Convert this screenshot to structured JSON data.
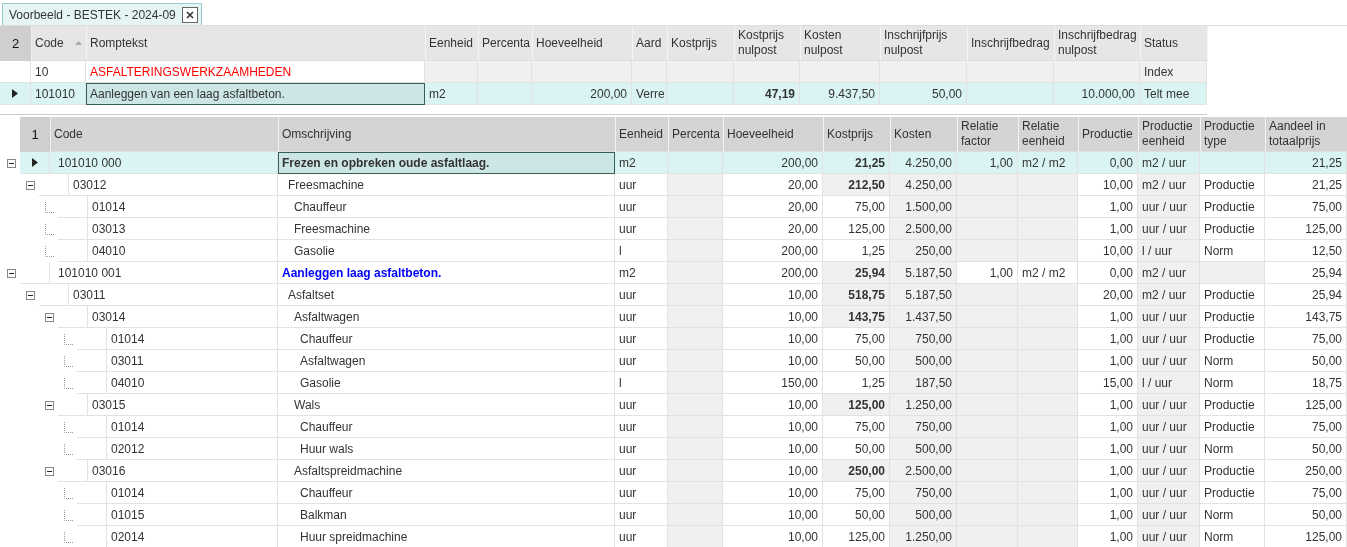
{
  "tab": {
    "title": "Voorbeeld - BESTEK - 2024-09"
  },
  "top_grid": {
    "level_indicator": "2",
    "columns": [
      {
        "label": "Code",
        "sorted": true
      },
      {
        "label": "Romptekst",
        "sorted": false
      },
      {
        "label": "Eenheid",
        "sorted": false
      },
      {
        "label": "Percenta",
        "sorted": false
      },
      {
        "label": "Hoeveelheid",
        "sorted": false
      },
      {
        "label": "Aard",
        "sorted": false
      },
      {
        "label": "Kostprijs",
        "sorted": false
      },
      {
        "label": "Kostprijs\nnulpost",
        "sorted": false
      },
      {
        "label": "Kosten\nnulpost",
        "sorted": false
      },
      {
        "label": "Inschrijfprijs\nnulpost",
        "sorted": false
      },
      {
        "label": "Inschrijfbedrag",
        "sorted": false
      },
      {
        "label": "Inschrijfbedrag\nnulpost",
        "sorted": false
      },
      {
        "label": "Status",
        "sorted": false
      }
    ],
    "rows": [
      {
        "kind": "group",
        "selected": false,
        "code": "10",
        "romptekst": "ASFALTERINGSWERKZAAMHEDEN",
        "status": "Index"
      },
      {
        "kind": "item",
        "selected": true,
        "code": "101010",
        "romptekst": "Aanleggen van een laag asfaltbeton.",
        "eenheid": "m2",
        "hoeveelheid": "200,00",
        "aard": "Verre",
        "kostprijs_nulpost": "47,19",
        "kosten_nulpost": "9.437,50",
        "inschrijfprijs_nulpost": "50,00",
        "inschrijfbedrag_nulpost": "10.000,00",
        "status": "Telt mee"
      }
    ]
  },
  "tree_grid": {
    "level_indicator": "1",
    "columns": [
      {
        "label": "Code"
      },
      {
        "label": "Omschrijving"
      },
      {
        "label": "Eenheid"
      },
      {
        "label": "Percenta"
      },
      {
        "label": "Hoeveelheid"
      },
      {
        "label": "Kostprijs"
      },
      {
        "label": "Kosten"
      },
      {
        "label": "Relatie\nfactor"
      },
      {
        "label": "Relatie\neenheid"
      },
      {
        "label": "Productie"
      },
      {
        "label": "Productie\neenheid"
      },
      {
        "label": "Productie\ntype"
      },
      {
        "label": "Aandeel in\ntotaalprijs"
      }
    ],
    "rows": [
      {
        "kind": "top",
        "selected": true,
        "expanded": true,
        "color": "#333333",
        "code": "101010 000",
        "omschrijving": "Frezen en opbreken oude asfaltlaag.",
        "eenheid": "m2",
        "hoeveelheid": "200,00",
        "kostprijs": "21,25",
        "kosten": "4.250,00",
        "relatie_factor": "1,00",
        "relatie_eenheid": "m2 / m2",
        "productie": "0,00",
        "productie_eenheid": "m2 / uur",
        "aandeel": "21,25",
        "children": [
          {
            "kind": "child",
            "selected": false,
            "expanded": true,
            "code": "03012",
            "omschrijving": "Freesmachine",
            "eenheid": "uur",
            "hoeveelheid": "20,00",
            "kostprijs": "212,50",
            "kosten": "4.250,00",
            "productie": "10,00",
            "productie_eenheid": "m2 / uur",
            "productie_type": "Productie",
            "aandeel": "21,25",
            "children": [
              {
                "kind": "child",
                "selected": false,
                "code": "01014",
                "omschrijving": "Chauffeur",
                "eenheid": "uur",
                "hoeveelheid": "20,00",
                "kostprijs": "75,00",
                "kosten": "1.500,00",
                "productie": "1,00",
                "productie_eenheid": "uur / uur",
                "productie_type": "Productie",
                "aandeel": "75,00"
              },
              {
                "kind": "child",
                "selected": false,
                "code": "03013",
                "omschrijving": "Freesmachine",
                "eenheid": "uur",
                "hoeveelheid": "20,00",
                "kostprijs": "125,00",
                "kosten": "2.500,00",
                "productie": "1,00",
                "productie_eenheid": "uur / uur",
                "productie_type": "Productie",
                "aandeel": "125,00"
              },
              {
                "kind": "child",
                "selected": false,
                "code": "04010",
                "omschrijving": "Gasolie",
                "eenheid": "l",
                "hoeveelheid": "200,00",
                "kostprijs": "1,25",
                "kosten": "250,00",
                "productie": "10,00",
                "productie_eenheid": "l / uur",
                "productie_type": "Norm",
                "aandeel": "12,50"
              }
            ]
          }
        ]
      },
      {
        "kind": "top",
        "selected": false,
        "expanded": true,
        "color": "#0000ff",
        "code": "101010 001",
        "omschrijving": "Aanleggen laag asfaltbeton.",
        "eenheid": "m2",
        "hoeveelheid": "200,00",
        "kostprijs": "25,94",
        "kosten": "5.187,50",
        "relatie_factor": "1,00",
        "relatie_eenheid": "m2 / m2",
        "productie": "0,00",
        "productie_eenheid": "m2 / uur",
        "aandeel": "25,94",
        "children": [
          {
            "kind": "child",
            "selected": false,
            "expanded": true,
            "code": "03011",
            "omschrijving": "Asfaltset",
            "eenheid": "uur",
            "hoeveelheid": "10,00",
            "kostprijs": "518,75",
            "kosten": "5.187,50",
            "productie": "20,00",
            "productie_eenheid": "m2 / uur",
            "productie_type": "Productie",
            "aandeel": "25,94",
            "children": [
              {
                "kind": "child",
                "selected": false,
                "expanded": true,
                "code": "03014",
                "omschrijving": "Asfaltwagen",
                "eenheid": "uur",
                "hoeveelheid": "10,00",
                "kostprijs": "143,75",
                "kosten": "1.437,50",
                "productie": "1,00",
                "productie_eenheid": "uur / uur",
                "productie_type": "Productie",
                "aandeel": "143,75",
                "children": [
                  {
                    "kind": "child",
                    "selected": false,
                    "code": "01014",
                    "omschrijving": "Chauffeur",
                    "eenheid": "uur",
                    "hoeveelheid": "10,00",
                    "kostprijs": "75,00",
                    "kosten": "750,00",
                    "productie": "1,00",
                    "productie_eenheid": "uur / uur",
                    "productie_type": "Productie",
                    "aandeel": "75,00"
                  },
                  {
                    "kind": "child",
                    "selected": false,
                    "code": "03011",
                    "omschrijving": "Asfaltwagen",
                    "eenheid": "uur",
                    "hoeveelheid": "10,00",
                    "kostprijs": "50,00",
                    "kosten": "500,00",
                    "productie": "1,00",
                    "productie_eenheid": "uur / uur",
                    "productie_type": "Norm",
                    "aandeel": "50,00"
                  },
                  {
                    "kind": "child",
                    "selected": false,
                    "code": "04010",
                    "omschrijving": "Gasolie",
                    "eenheid": "l",
                    "hoeveelheid": "150,00",
                    "kostprijs": "1,25",
                    "kosten": "187,50",
                    "productie": "15,00",
                    "productie_eenheid": "l / uur",
                    "productie_type": "Norm",
                    "aandeel": "18,75"
                  }
                ]
              },
              {
                "kind": "child",
                "selected": false,
                "expanded": true,
                "code": "03015",
                "omschrijving": "Wals",
                "eenheid": "uur",
                "hoeveelheid": "10,00",
                "kostprijs": "125,00",
                "kosten": "1.250,00",
                "productie": "1,00",
                "productie_eenheid": "uur / uur",
                "productie_type": "Productie",
                "aandeel": "125,00",
                "children": [
                  {
                    "kind": "child",
                    "selected": false,
                    "code": "01014",
                    "omschrijving": "Chauffeur",
                    "eenheid": "uur",
                    "hoeveelheid": "10,00",
                    "kostprijs": "75,00",
                    "kosten": "750,00",
                    "productie": "1,00",
                    "productie_eenheid": "uur / uur",
                    "productie_type": "Productie",
                    "aandeel": "75,00"
                  },
                  {
                    "kind": "child",
                    "selected": false,
                    "code": "02012",
                    "omschrijving": "Huur wals",
                    "eenheid": "uur",
                    "hoeveelheid": "10,00",
                    "kostprijs": "50,00",
                    "kosten": "500,00",
                    "productie": "1,00",
                    "productie_eenheid": "uur / uur",
                    "productie_type": "Norm",
                    "aandeel": "50,00"
                  }
                ]
              },
              {
                "kind": "child",
                "selected": false,
                "expanded": true,
                "code": "03016",
                "omschrijving": "Asfaltspreidmachine",
                "eenheid": "uur",
                "hoeveelheid": "10,00",
                "kostprijs": "250,00",
                "kosten": "2.500,00",
                "productie": "1,00",
                "productie_eenheid": "uur / uur",
                "productie_type": "Productie",
                "aandeel": "250,00",
                "children": [
                  {
                    "kind": "child",
                    "selected": false,
                    "code": "01014",
                    "omschrijving": "Chauffeur",
                    "eenheid": "uur",
                    "hoeveelheid": "10,00",
                    "kostprijs": "75,00",
                    "kosten": "750,00",
                    "productie": "1,00",
                    "productie_eenheid": "uur / uur",
                    "productie_type": "Productie",
                    "aandeel": "75,00"
                  },
                  {
                    "kind": "child",
                    "selected": false,
                    "code": "01015",
                    "omschrijving": "Balkman",
                    "eenheid": "uur",
                    "hoeveelheid": "10,00",
                    "kostprijs": "50,00",
                    "kosten": "500,00",
                    "productie": "1,00",
                    "productie_eenheid": "uur / uur",
                    "productie_type": "Norm",
                    "aandeel": "50,00"
                  },
                  {
                    "kind": "child",
                    "selected": false,
                    "code": "02014",
                    "omschrijving": "Huur spreidmachine",
                    "eenheid": "uur",
                    "hoeveelheid": "10,00",
                    "kostprijs": "125,00",
                    "kosten": "1.250,00",
                    "productie": "1,00",
                    "productie_eenheid": "uur / uur",
                    "productie_type": "Norm",
                    "aandeel": "125,00"
                  }
                ]
              }
            ]
          }
        ]
      }
    ]
  }
}
